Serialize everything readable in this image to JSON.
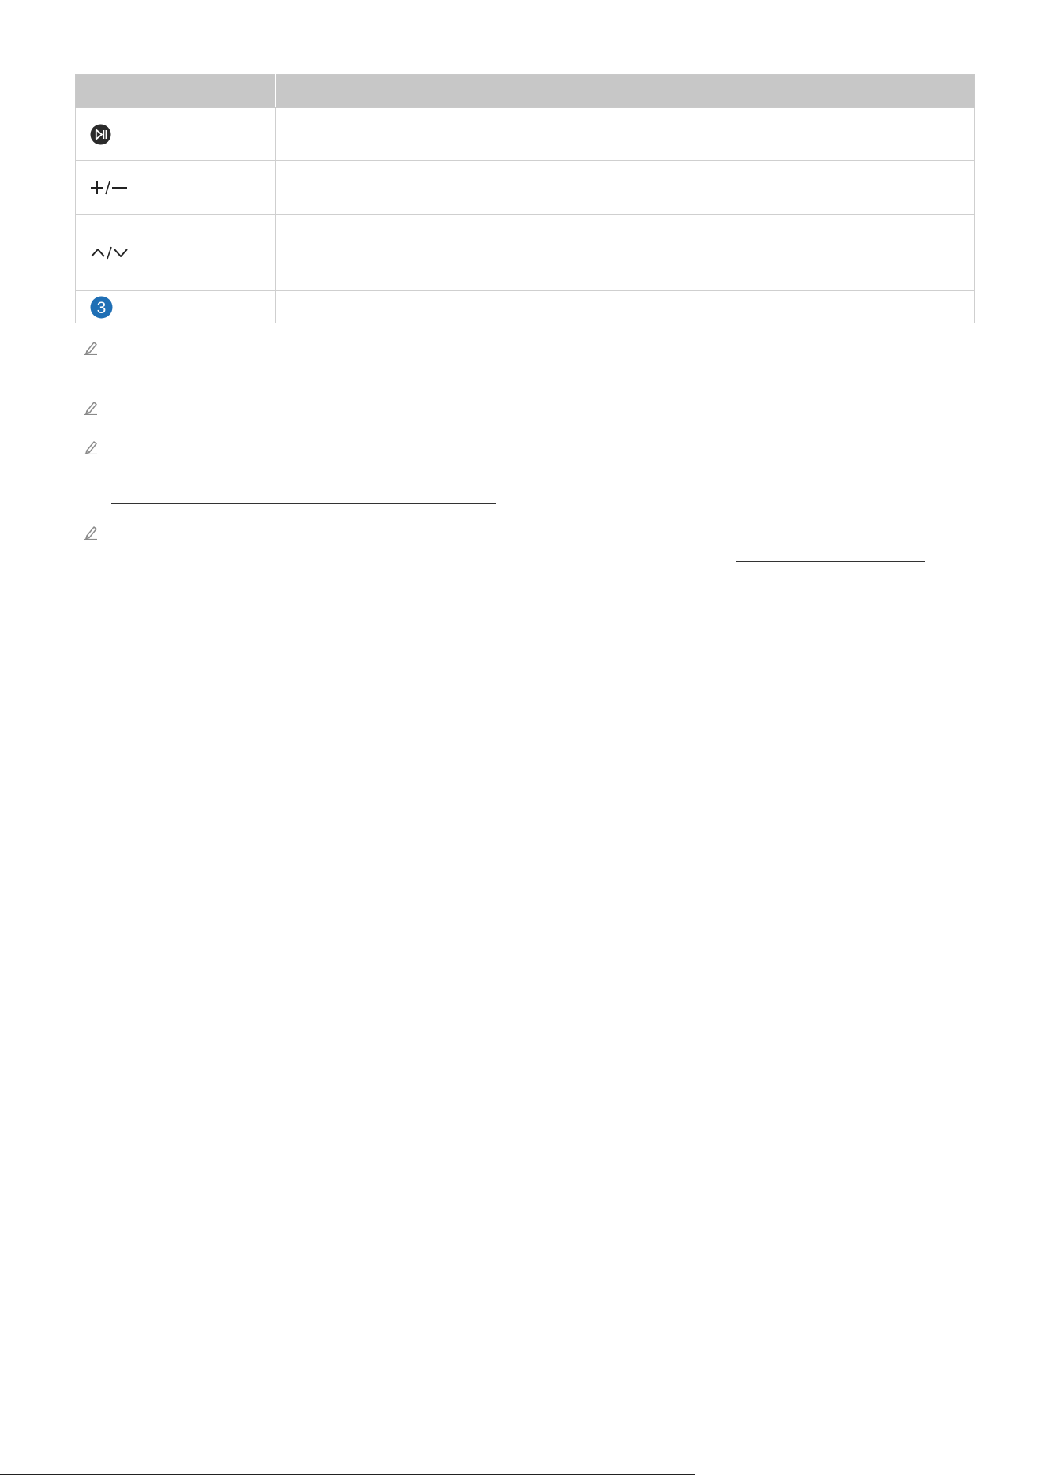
{
  "table": {
    "headers": [
      "",
      ""
    ],
    "rows": [
      {
        "icon": "play-pause-icon",
        "description": ""
      },
      {
        "icon": "volume-plus-minus-icon",
        "description": ""
      },
      {
        "icon": "channel-up-down-icon",
        "description": ""
      },
      {
        "icon": "number-3-blue-badge-icon",
        "badge_text": "3",
        "badge_color": "#1f6fb5",
        "description": ""
      }
    ]
  },
  "notes": [
    {
      "icon": "pencil-note-icon",
      "text": ""
    },
    {
      "icon": "pencil-note-icon",
      "text": ""
    },
    {
      "icon": "pencil-note-icon",
      "text": "",
      "link_text": ""
    },
    {
      "icon": "pencil-note-icon",
      "text": "",
      "link_text": ""
    }
  ],
  "footer": {
    "text": ""
  },
  "colors": {
    "header_bg": "#c7c7c7",
    "border": "#cfcfcf",
    "badge_blue": "#1f6fb5",
    "text": "#222222",
    "icon_gray": "#888888"
  }
}
